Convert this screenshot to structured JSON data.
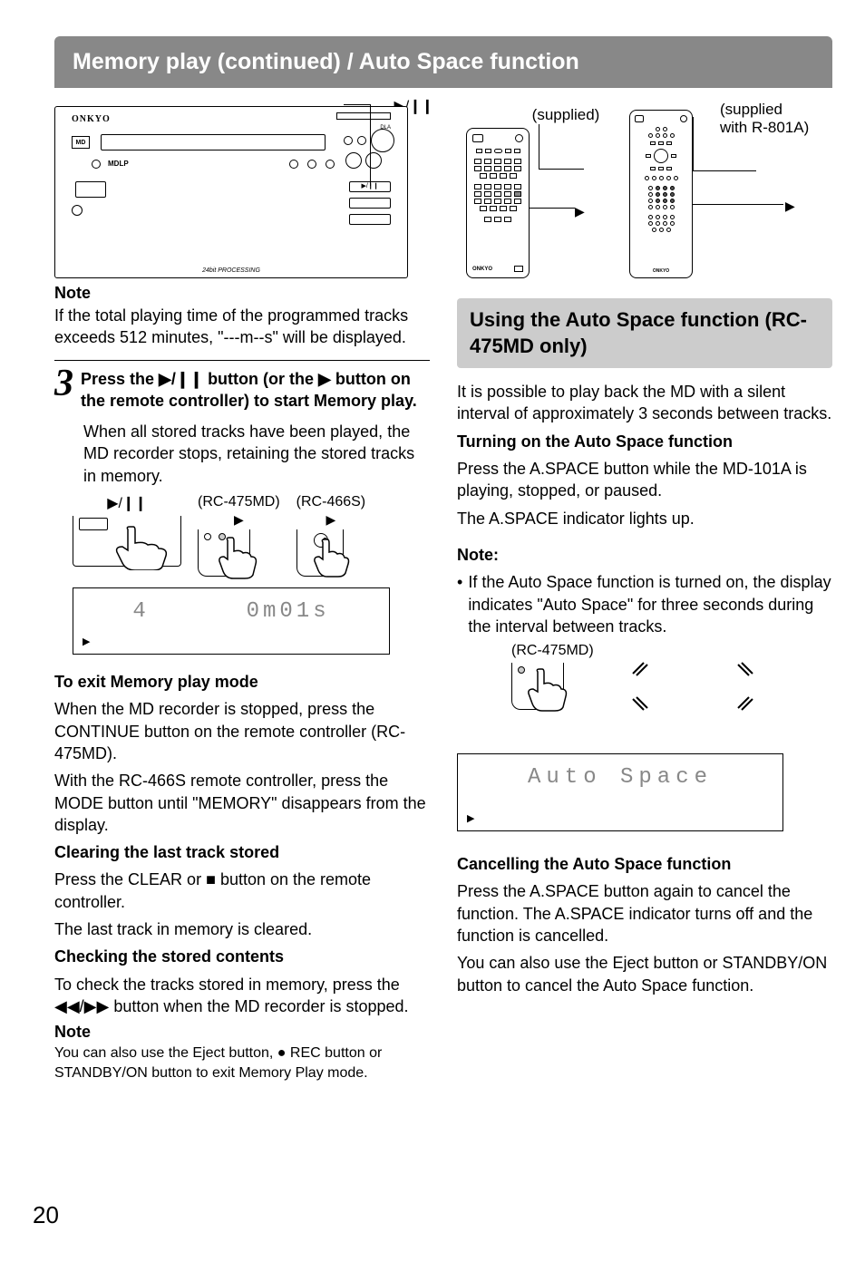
{
  "header": {
    "title": "Memory play (continued) / Auto Space function"
  },
  "left": {
    "play_pause_symbol": "▶/❙❙",
    "note_head": "Note",
    "note_body": "If the total playing time of the programmed tracks exceeds 512 minutes, \"---m--s\" will be displayed.",
    "step_num": "3",
    "step_text_1": "Press the ",
    "step_text_2": " button (or the ",
    "step_text_3": " button on the remote controller) to start Memory play.",
    "step_body": "When all stored tracks have been played, the MD recorder stops, retaining the stored tracks in memory.",
    "rc475_label": "(RC-475MD)",
    "rc466_label": "(RC-466S)",
    "display_values": {
      "track": "4",
      "time": "0m01s"
    },
    "exit_head": "To exit Memory play mode",
    "exit_body1": "When the MD recorder is stopped, press the CONTINUE button on the remote controller (RC-475MD).",
    "exit_body2": "With the RC-466S remote controller, press the MODE button until \"MEMORY\" disappears from the display.",
    "clear_head": "Clearing the last track stored",
    "clear_body1": "Press the CLEAR or ",
    "clear_body2": " button on the remote controller.",
    "clear_body3": "The last track in memory is cleared.",
    "check_head": "Checking the stored contents",
    "check_body1": "To check the tracks stored in memory, press the ",
    "check_body2": " button when the MD recorder is stopped.",
    "note2_head": "Note",
    "note2_body": "You can also use the Eject button, ● REC button or STANDBY/ON button to exit Memory Play mode.",
    "stop_symbol": "■",
    "skip_symbol": "◀◀/▶▶",
    "play_symbol": "▶"
  },
  "right": {
    "supplied": "(supplied)",
    "supplied_r801a": "(supplied with R-801A)",
    "play_symbol": "▶",
    "section_title": "Using the Auto Space function (RC-475MD only)",
    "intro": "It is possible to play back the MD with a silent interval of approximately 3 seconds between tracks.",
    "turn_on_head": "Turning on the Auto Space function",
    "turn_on_body1": "Press the A.SPACE button while the MD-101A is playing, stopped, or paused.",
    "turn_on_body2": "The A.SPACE indicator lights up.",
    "note_head": "Note:",
    "note_bullet": "If the Auto Space function is turned on, the display indicates \"Auto Space\" for three seconds during the interval between tracks.",
    "rc475_label": "(RC-475MD)",
    "display_text": "Auto Space",
    "cancel_head": "Cancelling the Auto Space function",
    "cancel_body1": "Press the A.SPACE button again to cancel the function. The A.SPACE indicator turns off and the function is cancelled.",
    "cancel_body2": "You can also use the Eject button or STANDBY/ON button to cancel the Auto Space function."
  },
  "page_number": "20"
}
